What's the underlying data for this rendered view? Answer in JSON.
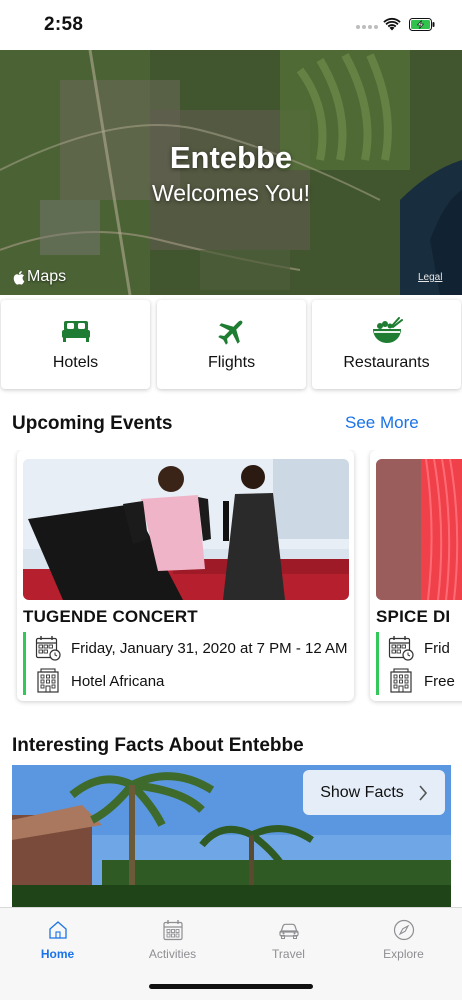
{
  "status_bar": {
    "time": "2:58"
  },
  "hero": {
    "title": "Entebbe",
    "subtitle": "Welcomes You!",
    "maps_brand": "Maps",
    "legal": "Legal"
  },
  "categories": [
    {
      "label": "Hotels",
      "icon": "bed-icon"
    },
    {
      "label": "Flights",
      "icon": "airplane-icon"
    },
    {
      "label": "Restaurants",
      "icon": "food-bowl-icon"
    }
  ],
  "colors": {
    "brand_green": "#1e7d32",
    "accent_blue": "#1a73e8",
    "event_bar": "#34c759"
  },
  "events_section": {
    "title": "Upcoming Events",
    "see_more": "See More"
  },
  "events": [
    {
      "name": "TUGENDE CONCERT",
      "date": "Friday, January 31, 2020 at 7 PM - 12 AM",
      "venue": "Hotel Africana"
    },
    {
      "name": "SPICE DI",
      "date": "Frid",
      "venue": "Free"
    }
  ],
  "facts_section": {
    "title": "Interesting Facts About Entebbe",
    "button": "Show Facts"
  },
  "tab_bar": {
    "tabs": [
      {
        "label": "Home",
        "icon": "house-icon",
        "active": true
      },
      {
        "label": "Activities",
        "icon": "calendar-icon",
        "active": false
      },
      {
        "label": "Travel",
        "icon": "car-icon",
        "active": false
      },
      {
        "label": "Explore",
        "icon": "compass-icon",
        "active": false
      }
    ]
  }
}
